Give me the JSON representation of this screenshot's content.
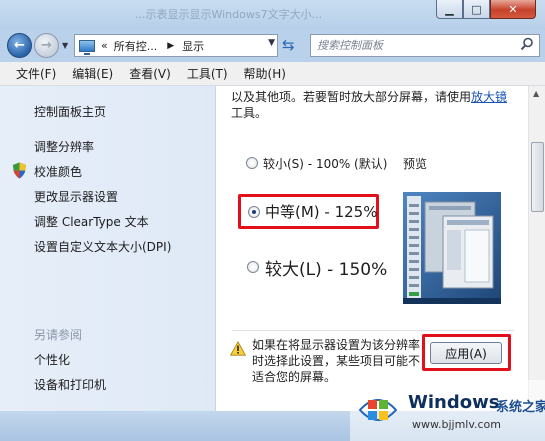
{
  "titlebar": {
    "ghost_title": "...示表显示显示Windows7文字大小..."
  },
  "address": {
    "prefix": "«",
    "path": [
      "所有控...",
      "显示"
    ]
  },
  "search": {
    "placeholder": "搜索控制面板"
  },
  "menu": [
    "文件(F)",
    "编辑(E)",
    "查看(V)",
    "工具(T)",
    "帮助(H)"
  ],
  "sidebar": {
    "items": [
      "控制面板主页",
      "调整分辨率",
      "校准颜色",
      "更改显示器设置",
      "调整 ClearType 文本",
      "设置自定义文本大小(DPI)"
    ],
    "see_also_heading": "另请参阅",
    "see_also": [
      "个性化",
      "设备和打印机"
    ]
  },
  "content": {
    "intro_line1": "以及其他项。若要暂时放大部分屏幕，请使用",
    "intro_link": "放大镜",
    "intro_line2": "工具。",
    "options": [
      {
        "label": "较小(S) - 100% (默认)",
        "checked": false
      },
      {
        "label": "中等(M) - 125%",
        "checked": true
      },
      {
        "label": "较大(L) - 150%",
        "checked": false
      }
    ],
    "preview_label": "预览",
    "warning_lines": [
      "如果在将显示器设置为该分辨率",
      "时选择此设置，某些项目可能不",
      "适合您的屏幕。"
    ],
    "apply_label": "应用(A)"
  },
  "watermark": {
    "brand": "Windows",
    "suffix": "系统之家",
    "url": "www.bjjmlv.com"
  }
}
